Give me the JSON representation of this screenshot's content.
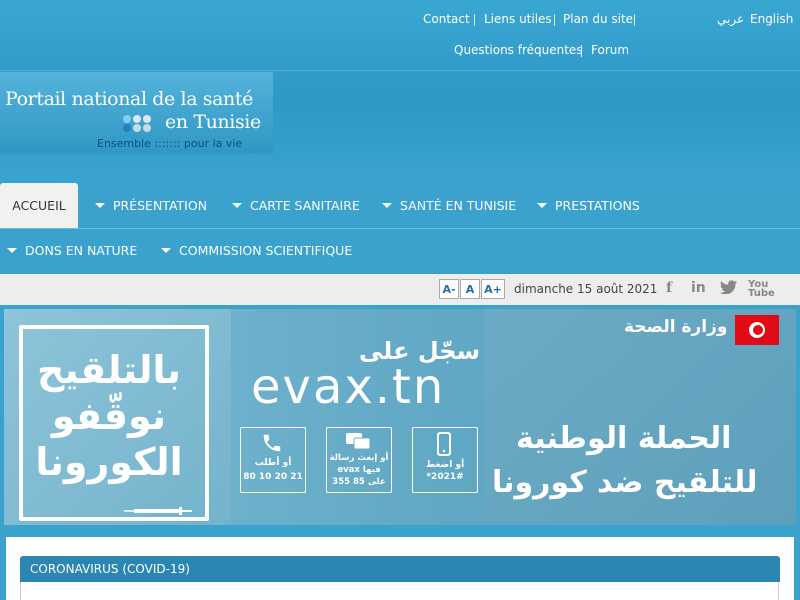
{
  "top_links": {
    "contact": "Contact",
    "liens_utiles": "Liens utiles",
    "plan_du_site": "Plan du site",
    "arabic": "عربي",
    "english": "English",
    "faq": "Questions fréquentes",
    "forum": "Forum"
  },
  "logo": {
    "line1": "Portail national de la santé",
    "line2": "en Tunisie",
    "tagline": "Ensemble ::::::: pour la vie"
  },
  "nav": {
    "items": [
      {
        "label": "ACCUEIL",
        "active": true
      },
      {
        "label": "PRÉSENTATION"
      },
      {
        "label": "CARTE SANITAIRE"
      },
      {
        "label": "SANTÉ EN TUNISIE"
      },
      {
        "label": "PRESTATIONS"
      },
      {
        "label": "DONS EN NATURE"
      },
      {
        "label": "COMMISSION SCIENTIFIQUE"
      }
    ]
  },
  "toolbar": {
    "font_decrease": "A-",
    "font_normal": "A",
    "font_increase": "A+",
    "date": "dimanche 15 août 2021"
  },
  "banner": {
    "left_slogan_1": "بالتلقيح",
    "left_slogan_2": "نوقّفو",
    "left_slogan_3": "الكورونا",
    "register_on": "سجّل على",
    "evax_url": "evax.tn",
    "call_text": "أو أطلب",
    "call_number": "80 10 20 21",
    "sms_text_1": "أو إبعث رسالة",
    "sms_text_2": "evax فيها",
    "sms_text_3": "على 85 355",
    "ussd_text": "أو اضغط",
    "ussd_code": "*2021#",
    "ministry": "وزارة الصحة",
    "campaign_1": "الحملة الوطنية",
    "campaign_2": "للتلقيح ضد كورونا"
  },
  "panel": {
    "title": "CORONAVIRUS (COVID-19)"
  },
  "colors": {
    "header_blue": "#3aa2cd",
    "panel_header": "#2c86b3",
    "flag_red": "#e30a17"
  }
}
